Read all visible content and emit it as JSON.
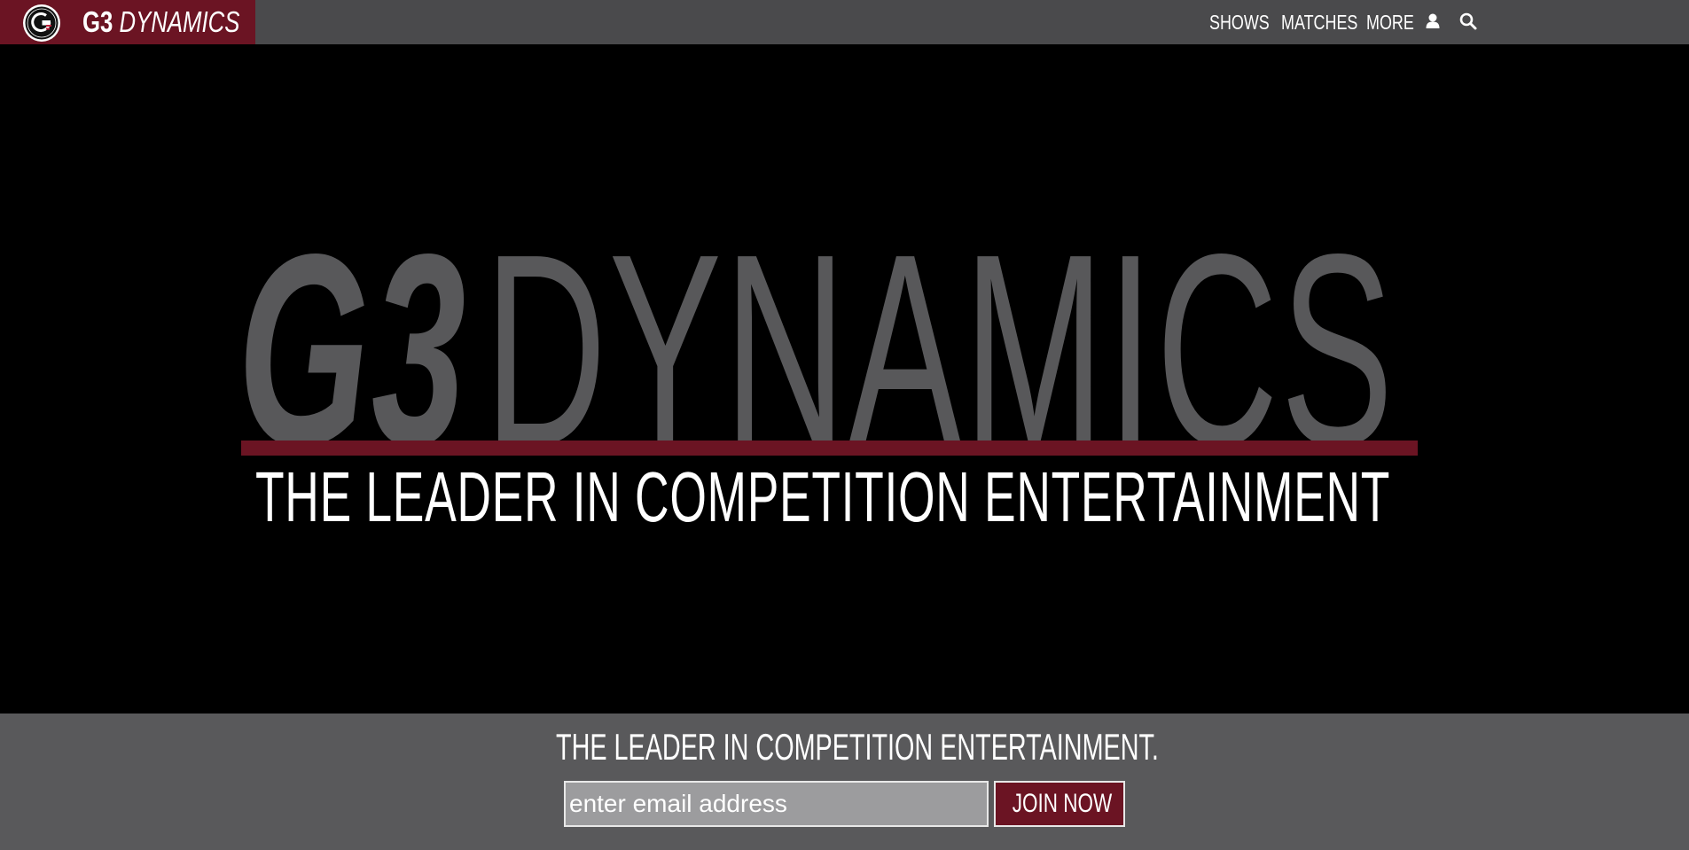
{
  "header": {
    "brand": {
      "part1": "G3",
      "part2": "DYNAMICS"
    },
    "nav": [
      {
        "label": "SHOWS"
      },
      {
        "label": "MATCHES"
      },
      {
        "label": "MORE"
      }
    ],
    "icons": {
      "user": "user-icon",
      "search": "search-icon"
    },
    "colors": {
      "bar": "#4a4a4c",
      "brand": "#6b1423"
    }
  },
  "hero": {
    "title_part1": "G3",
    "title_part2": "DYNAMICS",
    "tagline": "THE LEADER IN COMPETITION ENTERTAINMENT",
    "colors": {
      "title": "#58585a",
      "rule": "#6b1423",
      "background": "#000000"
    }
  },
  "signup": {
    "heading": "THE LEADER IN COMPETITION ENTERTAINMENT.",
    "email_placeholder": "enter email address",
    "button_label": "JOIN NOW",
    "colors": {
      "background": "#59595b",
      "button": "#6b1423"
    }
  }
}
